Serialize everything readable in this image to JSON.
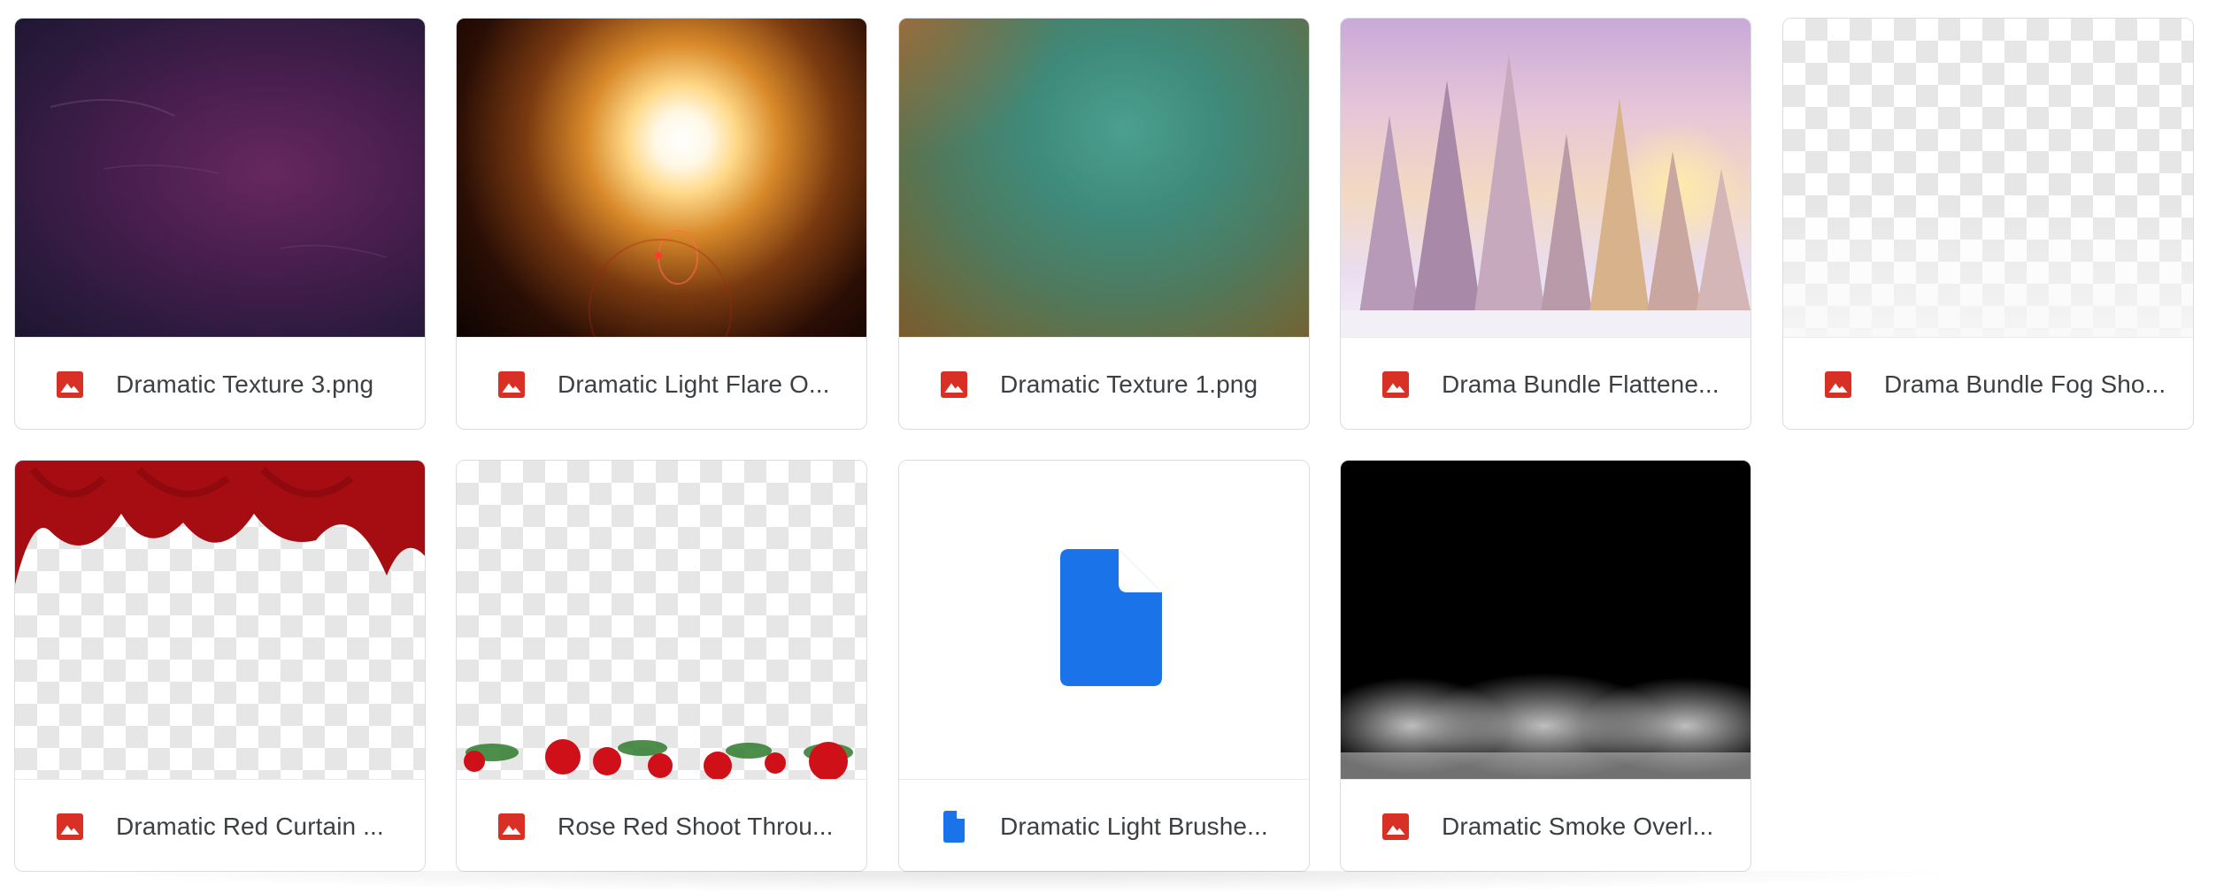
{
  "files": [
    {
      "name": "Dramatic Texture 3.png",
      "type": "image",
      "thumb": "purple-texture"
    },
    {
      "name": "Dramatic Light Flare O...",
      "type": "image",
      "thumb": "light-flare"
    },
    {
      "name": "Dramatic Texture 1.png",
      "type": "image",
      "thumb": "teal-texture"
    },
    {
      "name": "Drama Bundle Flattene...",
      "type": "image",
      "thumb": "snowy-forest"
    },
    {
      "name": "Drama Bundle Fog Sho...",
      "type": "image",
      "thumb": "fog-transparent"
    },
    {
      "name": "Dramatic Red Curtain ...",
      "type": "image",
      "thumb": "red-curtain"
    },
    {
      "name": "Rose Red Shoot Throu...",
      "type": "image",
      "thumb": "red-roses"
    },
    {
      "name": "Dramatic Light Brushe...",
      "type": "document",
      "thumb": "doc-icon"
    },
    {
      "name": "Dramatic Smoke Overl...",
      "type": "image",
      "thumb": "smoke"
    }
  ],
  "colors": {
    "image_icon": "#d93025",
    "document_icon": "#1a73e8",
    "card_border": "#dadce0",
    "filename_text": "#3c4043"
  }
}
